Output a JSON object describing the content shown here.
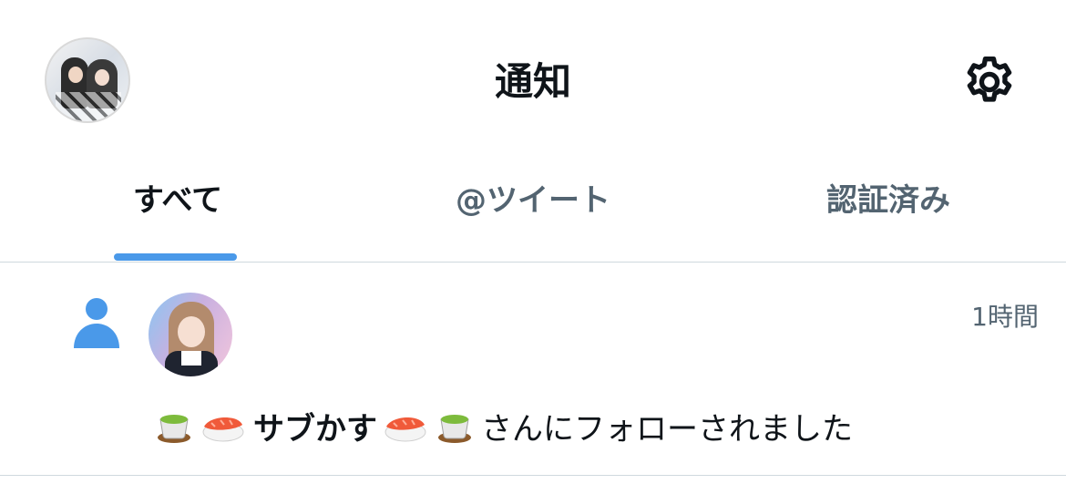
{
  "header": {
    "title": "通知",
    "settings_icon": "gear-icon",
    "avatar_icon": "account-avatar"
  },
  "tabs": [
    {
      "label": "すべて",
      "active": true
    },
    {
      "label": "@ツイート",
      "active": false
    },
    {
      "label": "認証済み",
      "active": false
    }
  ],
  "colors": {
    "accent": "#4a99e9",
    "text_primary": "#0f1419",
    "text_secondary": "#536471",
    "divider": "#cfd9de"
  },
  "notification": {
    "type_icon": "person-icon",
    "time": "1時間",
    "name": "サブかす",
    "name_emoji_left": [
      "green-tea-emoji",
      "sushi-emoji"
    ],
    "name_emoji_right": [
      "sushi-emoji",
      "green-tea-emoji"
    ],
    "message_suffix": "さんにフォローされました"
  }
}
